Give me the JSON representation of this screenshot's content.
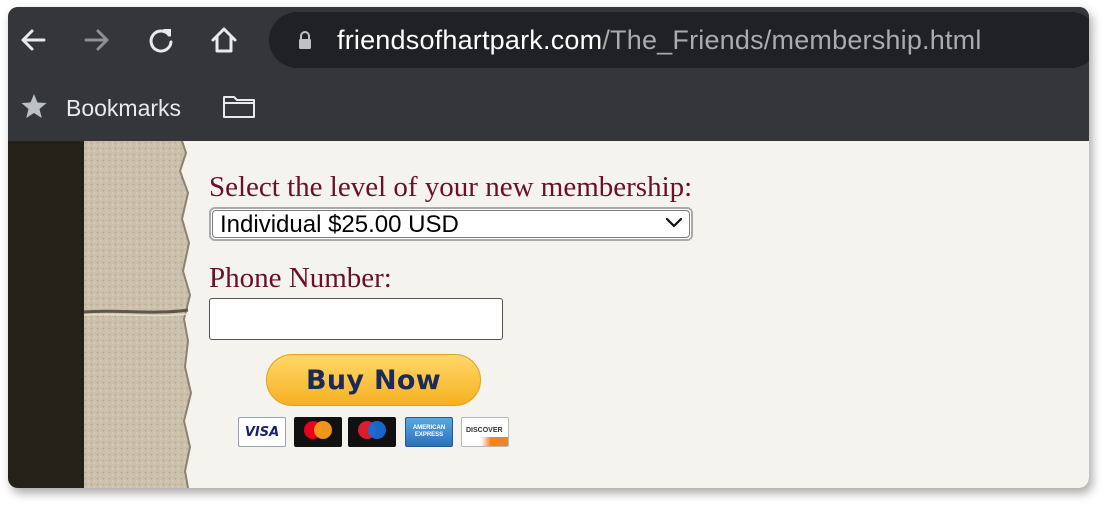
{
  "browser": {
    "url_domain": "friendsofhartpark.com",
    "url_path": "/The_Friends/membership.html",
    "nav_icons": [
      "back-arrow-icon",
      "forward-arrow-icon",
      "reload-icon",
      "home-icon"
    ],
    "lock_icon": "lock-icon"
  },
  "bookmarks_bar": {
    "label": "Bookmarks",
    "star_icon": "star-icon",
    "folder_icon": "folder-icon"
  },
  "form": {
    "level_label": "Select the level of your new membership:",
    "level_selected": "Individual $25.00 USD",
    "phone_label": "Phone Number:",
    "phone_value": "",
    "buy_button": "Buy Now",
    "payment_cards": [
      "VISA",
      "mastercard",
      "maestro",
      "AMERICAN EXPRESS",
      "DISCOVER"
    ]
  },
  "colors": {
    "label_color": "#6b0f2a",
    "page_bg": "#f4f3ed",
    "chrome_bg": "#35363a",
    "omnibox_bg": "#202124",
    "buy_button": "#f6b021"
  }
}
